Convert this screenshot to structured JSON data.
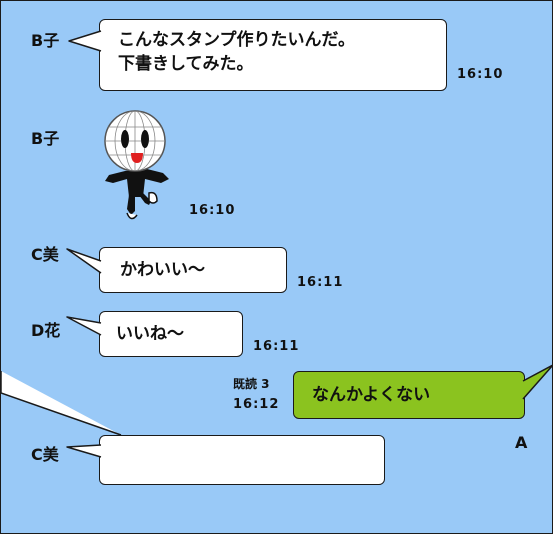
{
  "messages": [
    {
      "sender": "B子",
      "lines": [
        "こんなスタンプ作りたいんだ。",
        "下書きしてみた。"
      ],
      "time": "16:10"
    },
    {
      "sender": "B子",
      "sticker": "smiley-globe-character",
      "time": "16:10"
    },
    {
      "sender": "C美",
      "text": "かわいい〜",
      "time": "16:11"
    },
    {
      "sender": "D花",
      "text": "いいね〜",
      "time": "16:11"
    },
    {
      "sender": "A",
      "text": "なんかよくない",
      "read": "既読 3",
      "time": "16:12"
    },
    {
      "sender": "C美",
      "text": ""
    }
  ],
  "colors": {
    "background": "#99c9f7",
    "own_bubble": "#8bc31f",
    "other_bubble": "#ffffff"
  }
}
